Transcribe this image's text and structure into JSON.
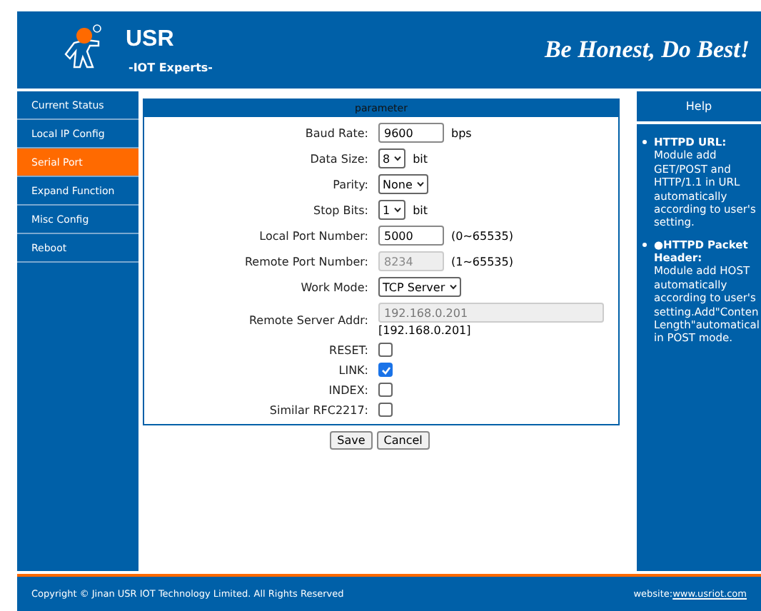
{
  "header": {
    "brand": "USR",
    "tagline": "-IOT Experts-",
    "motto": "Be Honest, Do Best!"
  },
  "sidebar": {
    "items": [
      {
        "label": "Current Status",
        "selected": false
      },
      {
        "label": "Local IP Config",
        "selected": false
      },
      {
        "label": "Serial Port",
        "selected": true
      },
      {
        "label": "Expand Function",
        "selected": false
      },
      {
        "label": "Misc Config",
        "selected": false
      },
      {
        "label": "Reboot",
        "selected": false
      }
    ]
  },
  "form": {
    "title": "parameter",
    "fields": [
      {
        "kind": "input",
        "label": "Baud Rate:",
        "value": "9600",
        "suffix": "bps",
        "disabled": false
      },
      {
        "kind": "select",
        "label": "Data Size:",
        "value": "8",
        "suffix": "bit"
      },
      {
        "kind": "select",
        "label": "Parity:",
        "value": "None"
      },
      {
        "kind": "select",
        "label": "Stop Bits:",
        "value": "1",
        "suffix": "bit"
      },
      {
        "kind": "input",
        "label": "Local Port Number:",
        "value": "5000",
        "suffix": "(0~65535)",
        "disabled": false
      },
      {
        "kind": "input",
        "label": "Remote Port Number:",
        "value": "8234",
        "suffix": "(1~65535)",
        "disabled": true
      },
      {
        "kind": "select",
        "label": "Work Mode:",
        "value": "TCP Server"
      },
      {
        "kind": "wide",
        "label": "Remote Server Addr:",
        "value": "192.168.0.201",
        "note": "[192.168.0.201]",
        "disabled": true
      },
      {
        "kind": "checkbox",
        "label": "RESET:",
        "checked": false
      },
      {
        "kind": "checkbox",
        "label": "LINK:",
        "checked": true
      },
      {
        "kind": "checkbox",
        "label": "INDEX:",
        "checked": false
      },
      {
        "kind": "checkbox",
        "label": "Similar RFC2217:",
        "checked": false
      }
    ],
    "buttons": [
      "Save",
      "Cancel"
    ]
  },
  "help": {
    "title": "Help",
    "items": [
      {
        "title": "HTTPD URL:",
        "body": "Module add GET/POST and HTTP/1.1 in URL automatically according to user's setting."
      },
      {
        "title": "●HTTPD Packet Header:",
        "body": "Module add HOST automatically according to user's setting.Add\"Conten Length\"automatical in POST mode."
      }
    ]
  },
  "footer": {
    "copyright": "Copyright © Jinan USR IOT Technology Limited. All Rights Reserved",
    "website_label": "website:",
    "website_link": "www.usriot.com"
  }
}
